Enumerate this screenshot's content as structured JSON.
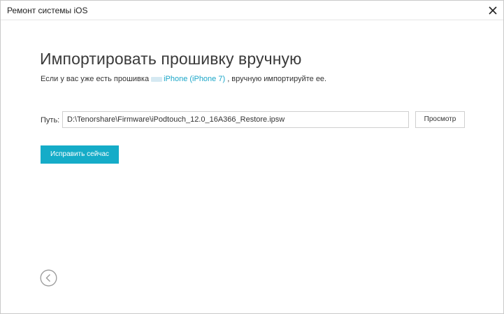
{
  "window": {
    "title": "Ремонт системы iOS"
  },
  "main": {
    "heading": "Импортировать прошивку вручную",
    "subtitle_prefix": "Если у вас уже есть прошивка",
    "device_link": "iPhone (iPhone 7)",
    "subtitle_suffix": ", вручную импортируйте ее."
  },
  "path": {
    "label": "Путь:",
    "value": "D:\\Tenorshare\\Firmware\\iPodtouch_12.0_16A366_Restore.ipsw",
    "browse_label": "Просмотр"
  },
  "actions": {
    "fix_label": "Исправить сейчас"
  },
  "icons": {
    "close": "close-icon",
    "back": "back-arrow-icon"
  },
  "colors": {
    "accent": "#15acc8",
    "link": "#1aa6c8"
  }
}
